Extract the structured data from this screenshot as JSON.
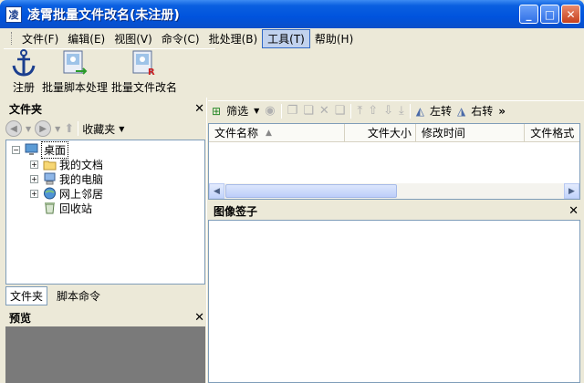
{
  "window": {
    "title": "凌霄批量文件改名(未注册)",
    "minimize": "_",
    "maximize": "□",
    "close": "✕"
  },
  "menu": [
    {
      "label": "文件(F)"
    },
    {
      "label": "编辑(E)"
    },
    {
      "label": "视图(V)"
    },
    {
      "label": "命令(C)"
    },
    {
      "label": "批处理(B)"
    },
    {
      "label": "工具(T)"
    },
    {
      "label": "帮助(H)"
    }
  ],
  "bigtoolbar": {
    "register": "注册",
    "batch_script": "批量脚本处理",
    "batch_rename": "批量文件改名"
  },
  "folder_panel": {
    "title": "文件夹",
    "close": "✕",
    "favorites": "收藏夹",
    "tree": {
      "desktop": "桌面",
      "my_documents": "我的文档",
      "my_computer": "我的电脑",
      "network": "网上邻居",
      "recycle_bin": "回收站"
    },
    "tabs": {
      "folder": "文件夹",
      "script": "脚本命令"
    }
  },
  "preview_panel": {
    "title": "预览",
    "close": "✕"
  },
  "right_toolbar": {
    "filter": "筛选",
    "rotate_left": "左转",
    "rotate_right": "右转",
    "more": "»"
  },
  "file_list": {
    "columns": [
      "文件名称",
      "文件大小",
      "修改时间",
      "文件格式"
    ],
    "sort_indicator": "▲"
  },
  "image_panel": {
    "title": "图像签子",
    "close": "✕"
  },
  "colors": {
    "title_bar": "#0053dd",
    "window_bg": "#ece9d8",
    "border": "#7f9db9"
  }
}
